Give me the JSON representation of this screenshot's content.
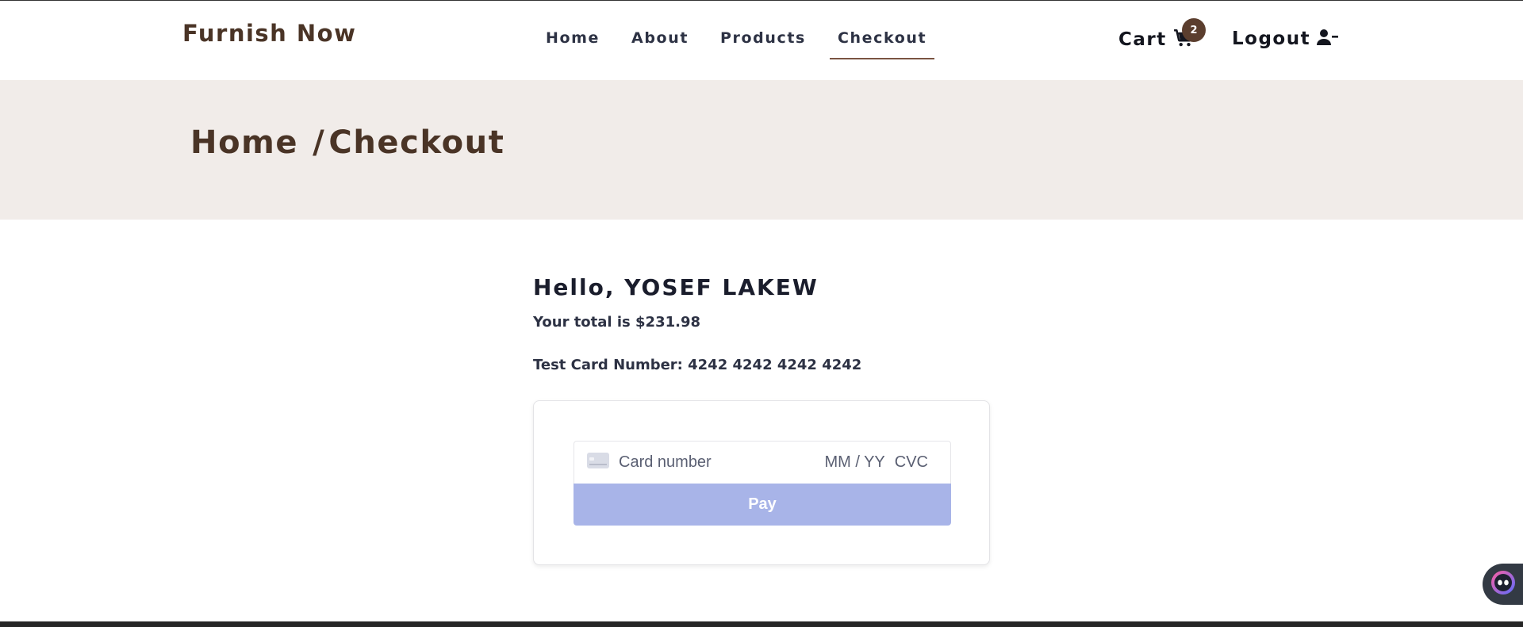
{
  "header": {
    "brand": "Furnish Now",
    "nav": [
      {
        "label": "Home",
        "active": false
      },
      {
        "label": "About",
        "active": false
      },
      {
        "label": "Products",
        "active": false
      },
      {
        "label": "Checkout",
        "active": true
      }
    ],
    "cart_label": "Cart",
    "cart_count": "2",
    "logout_label": "Logout",
    "icons": {
      "cart": "shopping-cart-icon",
      "logout": "user-minus-icon"
    }
  },
  "breadcrumb": {
    "home": "Home",
    "separator": "/",
    "current": "Checkout"
  },
  "checkout": {
    "greeting": "Hello, YOSEF LAKEW",
    "total_text": "Your total is $231.98",
    "test_card_text": "Test Card Number: 4242 4242 4242 4242",
    "card_number_placeholder": "Card number",
    "expiry_placeholder": "MM / YY",
    "cvc_placeholder": "CVC",
    "pay_label": "Pay"
  },
  "colors": {
    "brand": "#4a3426",
    "banner_bg": "#f1ece9",
    "pay_button": "#a8b4e8",
    "badge": "#5b3e2e"
  }
}
